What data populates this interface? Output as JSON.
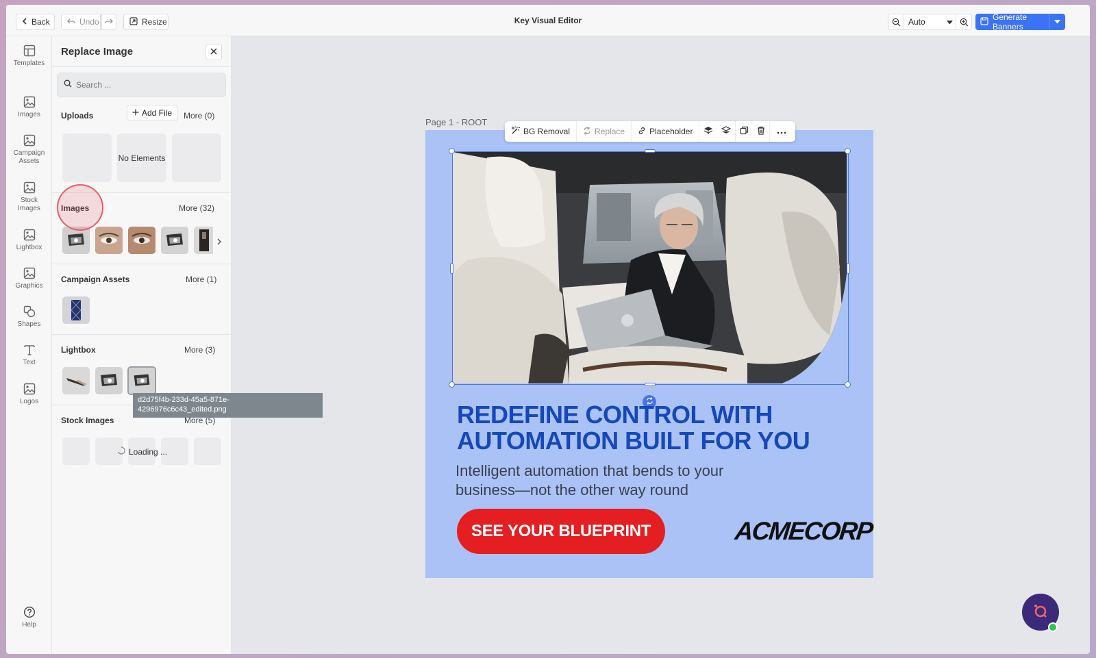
{
  "topbar": {
    "back_label": "Back",
    "undo_label": "Undo",
    "resize_label": "Resize",
    "title": "Key Visual Editor",
    "zoom_value": "Auto",
    "generate_label": "Generate Banners"
  },
  "rail": {
    "items": [
      {
        "label": "Templates",
        "icon": "templates-icon"
      },
      {
        "label": "Images",
        "icon": "image-icon"
      },
      {
        "label": "Campaign Assets",
        "icon": "image-icon"
      },
      {
        "label": "Stock Images",
        "icon": "image-icon"
      },
      {
        "label": "Lightbox",
        "icon": "image-icon"
      },
      {
        "label": "Graphics",
        "icon": "image-icon"
      },
      {
        "label": "Shapes",
        "icon": "shapes-icon"
      },
      {
        "label": "Text",
        "icon": "text-icon"
      },
      {
        "label": "Logos",
        "icon": "image-icon"
      }
    ],
    "help_label": "Help"
  },
  "panel": {
    "title": "Replace Image",
    "search_placeholder": "Search ...",
    "uploads": {
      "label": "Uploads",
      "add_label": "Add File",
      "more_label": "More (0)",
      "empty_label": "No Elements"
    },
    "images": {
      "label": "Images",
      "more_label": "More (32)"
    },
    "campaign_assets": {
      "label": "Campaign Assets",
      "more_label": "More (1)"
    },
    "lightbox": {
      "label": "Lightbox",
      "more_label": "More (3)"
    },
    "stock_images": {
      "label": "Stock Images",
      "more_label": "More (5)",
      "loading_label": "Loading ..."
    },
    "tooltip": "d2d75f4b-233d-45a5-871e-4296976c6c43_edited.png"
  },
  "canvas": {
    "page_label": "Page 1 - ROOT",
    "toolbar": {
      "bg_removal": "BG Removal",
      "replace": "Replace",
      "placeholder": "Placeholder"
    },
    "headline": "REDEFINE CONTROL WITH AUTOMATION BUILT FOR YOU",
    "subline": "Intelligent automation that bends to your business—not the other way round",
    "cta": "SEE YOUR BLUEPRINT",
    "logo": "ACMECORP"
  },
  "colors": {
    "accent": "#3b73f6",
    "banner_bg": "#aac2f6",
    "headline": "#1548b8",
    "cta": "#e41e21"
  }
}
